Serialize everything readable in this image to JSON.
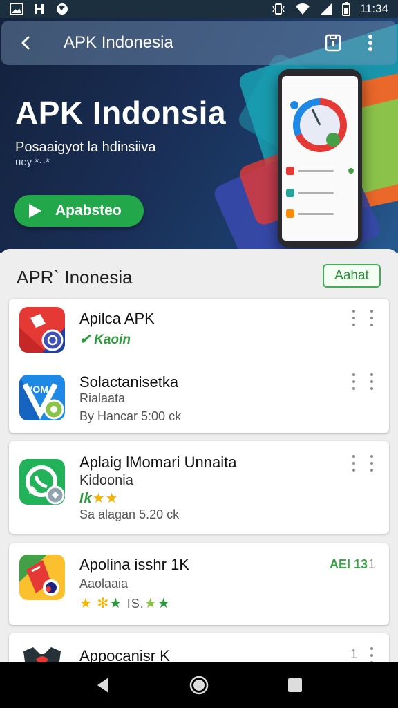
{
  "status_bar": {
    "time": "11:34"
  },
  "app_bar": {
    "title": "APK Indonesia"
  },
  "hero": {
    "title": "APK Indonsia",
    "subtitle": "Posaaigyot la hdinsiiva",
    "subtitle2": "uey *··*",
    "cta_label": "Apabsteo"
  },
  "section": {
    "title": "APR` Inonesia",
    "see_all": "Aahat"
  },
  "apps": [
    {
      "name": "Apilca APK",
      "tag": "Kaoin"
    },
    {
      "name": "Solactanisetka",
      "sub": "Rialaata",
      "meta": "By Hancar 5:00 ck"
    },
    {
      "name": "Aplaig lMomari Unnaita",
      "sub": "Kidoonia",
      "rating_prefix": "Ik",
      "meta": "Sa alagan 5.20 ck"
    },
    {
      "name": "Apolina isshr 1K",
      "sub": "Aaolaaia",
      "rating_mid": "IS.",
      "badge": "AEI 13",
      "badge2": "1"
    },
    {
      "name": "Appocanisr K",
      "badge2": "1"
    }
  ],
  "colors": {
    "accent_green": "#22a84a",
    "hero_bg": "#1a2f57"
  }
}
